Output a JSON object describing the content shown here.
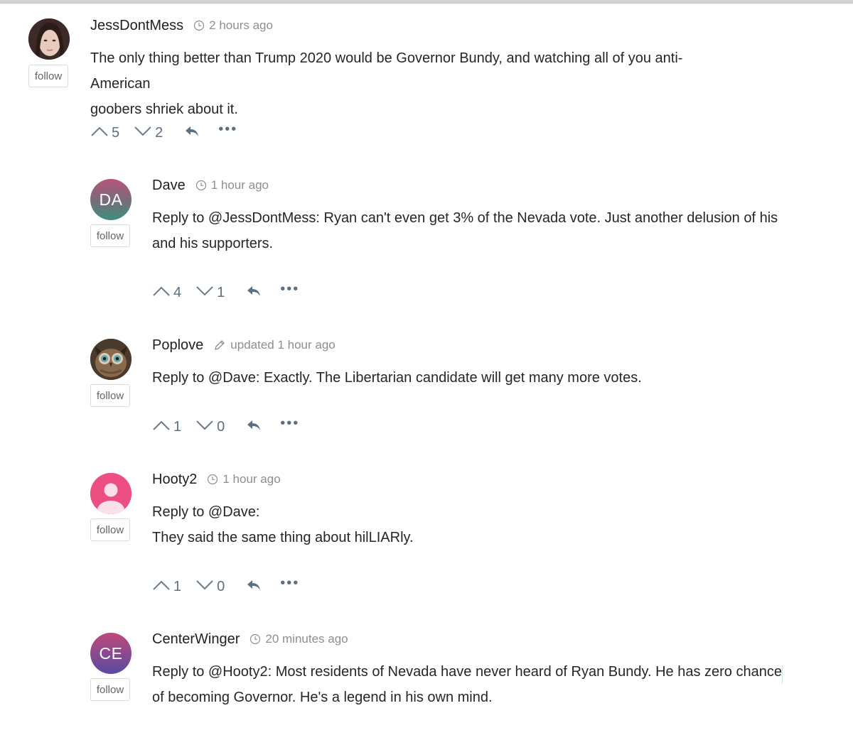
{
  "comments": [
    {
      "author": "JessDontMess",
      "time": "2 hours ago",
      "follow": "follow",
      "lines": [
        "The only thing better than Trump 2020 would be Governor Bundy, and watching all of you anti-American",
        "goobers shriek about it."
      ],
      "upvotes": "5",
      "downvotes": "2",
      "more": "•••",
      "avatar": {
        "type": "photo",
        "bg": "#6b4a3e"
      }
    },
    {
      "author": "Dave",
      "time": "1 hour ago",
      "follow": "follow",
      "lines": [
        "Reply to @JessDontMess: Ryan can't even get 3% of the Nevada vote. Just another delusion of his",
        "and his supporters."
      ],
      "upvotes": "4",
      "downvotes": "1",
      "more": "•••",
      "avatar": {
        "type": "initials",
        "initials": "DA",
        "color_top": "#b6567a",
        "color_bottom": "#3f8f7d"
      }
    },
    {
      "author": "Poplove",
      "time": "updated 1 hour ago",
      "follow": "follow",
      "lines": [
        "Reply to @Dave: Exactly. The Libertarian candidate will get many more votes."
      ],
      "upvotes": "1",
      "downvotes": "0",
      "more": "•••",
      "avatar": {
        "type": "owl",
        "bg": "#5a4a3a"
      }
    },
    {
      "author": "Hooty2",
      "time": "1 hour ago",
      "follow": "follow",
      "lines": [
        "Reply to @Dave:",
        "They said the same thing about hilLIARly."
      ],
      "upvotes": "1",
      "downvotes": "0",
      "more": "•••",
      "avatar": {
        "type": "default-user",
        "bg": "#ec4f82"
      }
    },
    {
      "author": "CenterWinger",
      "time": "20 minutes ago",
      "follow": "follow",
      "lines": [
        "Reply to @Hooty2: Most residents of Nevada have never heard of Ryan Bundy. He has zero chance",
        "of becoming Governor. He's a legend in his own mind."
      ],
      "avatar": {
        "type": "initials",
        "initials": "CE",
        "color_top": "#c0497b",
        "color_bottom": "#5a4aa0"
      }
    }
  ],
  "icons": {
    "clock": "clock-icon",
    "pencil": "pencil-icon",
    "upvote": "chevron-up-icon",
    "downvote": "chevron-down-icon",
    "reply": "reply-arrow-icon",
    "more": "more-dots-icon"
  },
  "colors": {
    "action": "#5c7082",
    "meta": "#8e8e8e",
    "text": "#262626"
  }
}
